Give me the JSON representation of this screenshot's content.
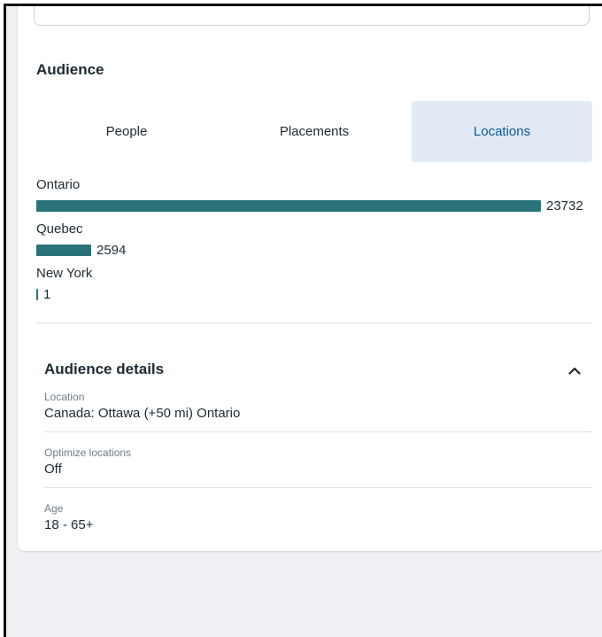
{
  "audience": {
    "title": "Audience",
    "tabs": [
      {
        "label": "People",
        "selected": false
      },
      {
        "label": "Placements",
        "selected": false
      },
      {
        "label": "Locations",
        "selected": true
      }
    ],
    "locations": [
      {
        "name": "Ontario",
        "value": "23732"
      },
      {
        "name": "Quebec",
        "value": "2594"
      },
      {
        "name": "New York",
        "value": "1"
      }
    ]
  },
  "details": {
    "title": "Audience details",
    "toggle_icon": "chevron-up-icon",
    "fields": [
      {
        "label": "Location",
        "value": "Canada: Ottawa (+50 mi) Ontario"
      },
      {
        "label": "Optimize locations",
        "value": "Off"
      },
      {
        "label": "Age",
        "value": "18 - 65+"
      }
    ]
  },
  "colors": {
    "bar": "#2a7479",
    "selected_tab_bg": "#e1eaf4",
    "selected_tab_text": "#0b5394",
    "page_bg": "#f0eff3"
  }
}
